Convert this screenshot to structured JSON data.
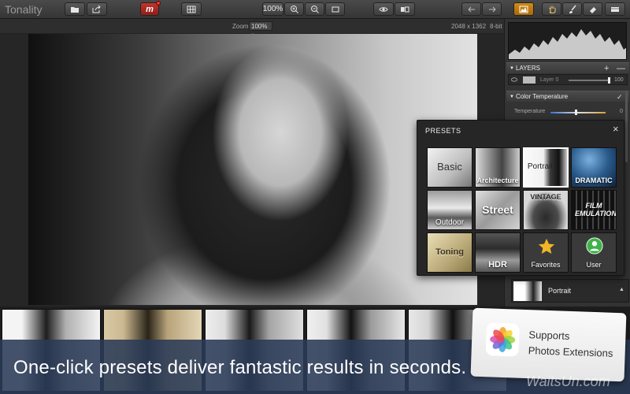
{
  "app": {
    "title": "Tonality"
  },
  "toolbar": {
    "zoom_percent": "100%",
    "icons": [
      "folder-icon",
      "share-icon",
      "plugin-m-icon",
      "grid-icon",
      "zoom-in-icon",
      "zoom-out-icon",
      "fit-icon",
      "eye-icon",
      "compare-icon",
      "undo-icon",
      "redo-icon",
      "histogram-icon",
      "hand-icon",
      "brush-icon",
      "eraser-icon",
      "panel-icon"
    ],
    "plugin_label": "m",
    "accent_color": "#d08a18"
  },
  "infobar": {
    "zoom_label": "Zoom",
    "zoom_value": "100%",
    "dimensions": "2048 x 1362",
    "bit_depth": "8-bit"
  },
  "panel": {
    "layers": {
      "title": "LAYERS",
      "add": "+",
      "remove": "—",
      "layer_name": "Layer 0",
      "opacity": "100"
    },
    "color_temperature": {
      "title": "Color Temperature",
      "check": "✓",
      "label": "Temperature",
      "value": "0",
      "level": 0.5
    },
    "current_preset": {
      "name": "Portrait"
    }
  },
  "presets": {
    "title": "PRESETS",
    "close": "×",
    "items": [
      {
        "label": "Basic",
        "selected": false
      },
      {
        "label": "Architecture",
        "selected": false
      },
      {
        "label": "Portrait",
        "selected": true
      },
      {
        "label": "DRAMATIC",
        "selected": false
      },
      {
        "label": "Outdoor",
        "selected": false
      },
      {
        "label": "Street",
        "selected": false
      },
      {
        "label": "VINTAGE",
        "selected": false
      },
      {
        "label": "FILM EMULATION",
        "selected": false
      },
      {
        "label": "Toning",
        "selected": false
      },
      {
        "label": "HDR",
        "selected": false
      },
      {
        "label": "Favorites",
        "selected": false
      },
      {
        "label": "User",
        "selected": false
      }
    ]
  },
  "caption": {
    "text": "One-click presets deliver fantastic results in seconds."
  },
  "card": {
    "line1": "Supports",
    "line2": "Photos Extensions"
  },
  "watermark": "WaitsUn.com"
}
